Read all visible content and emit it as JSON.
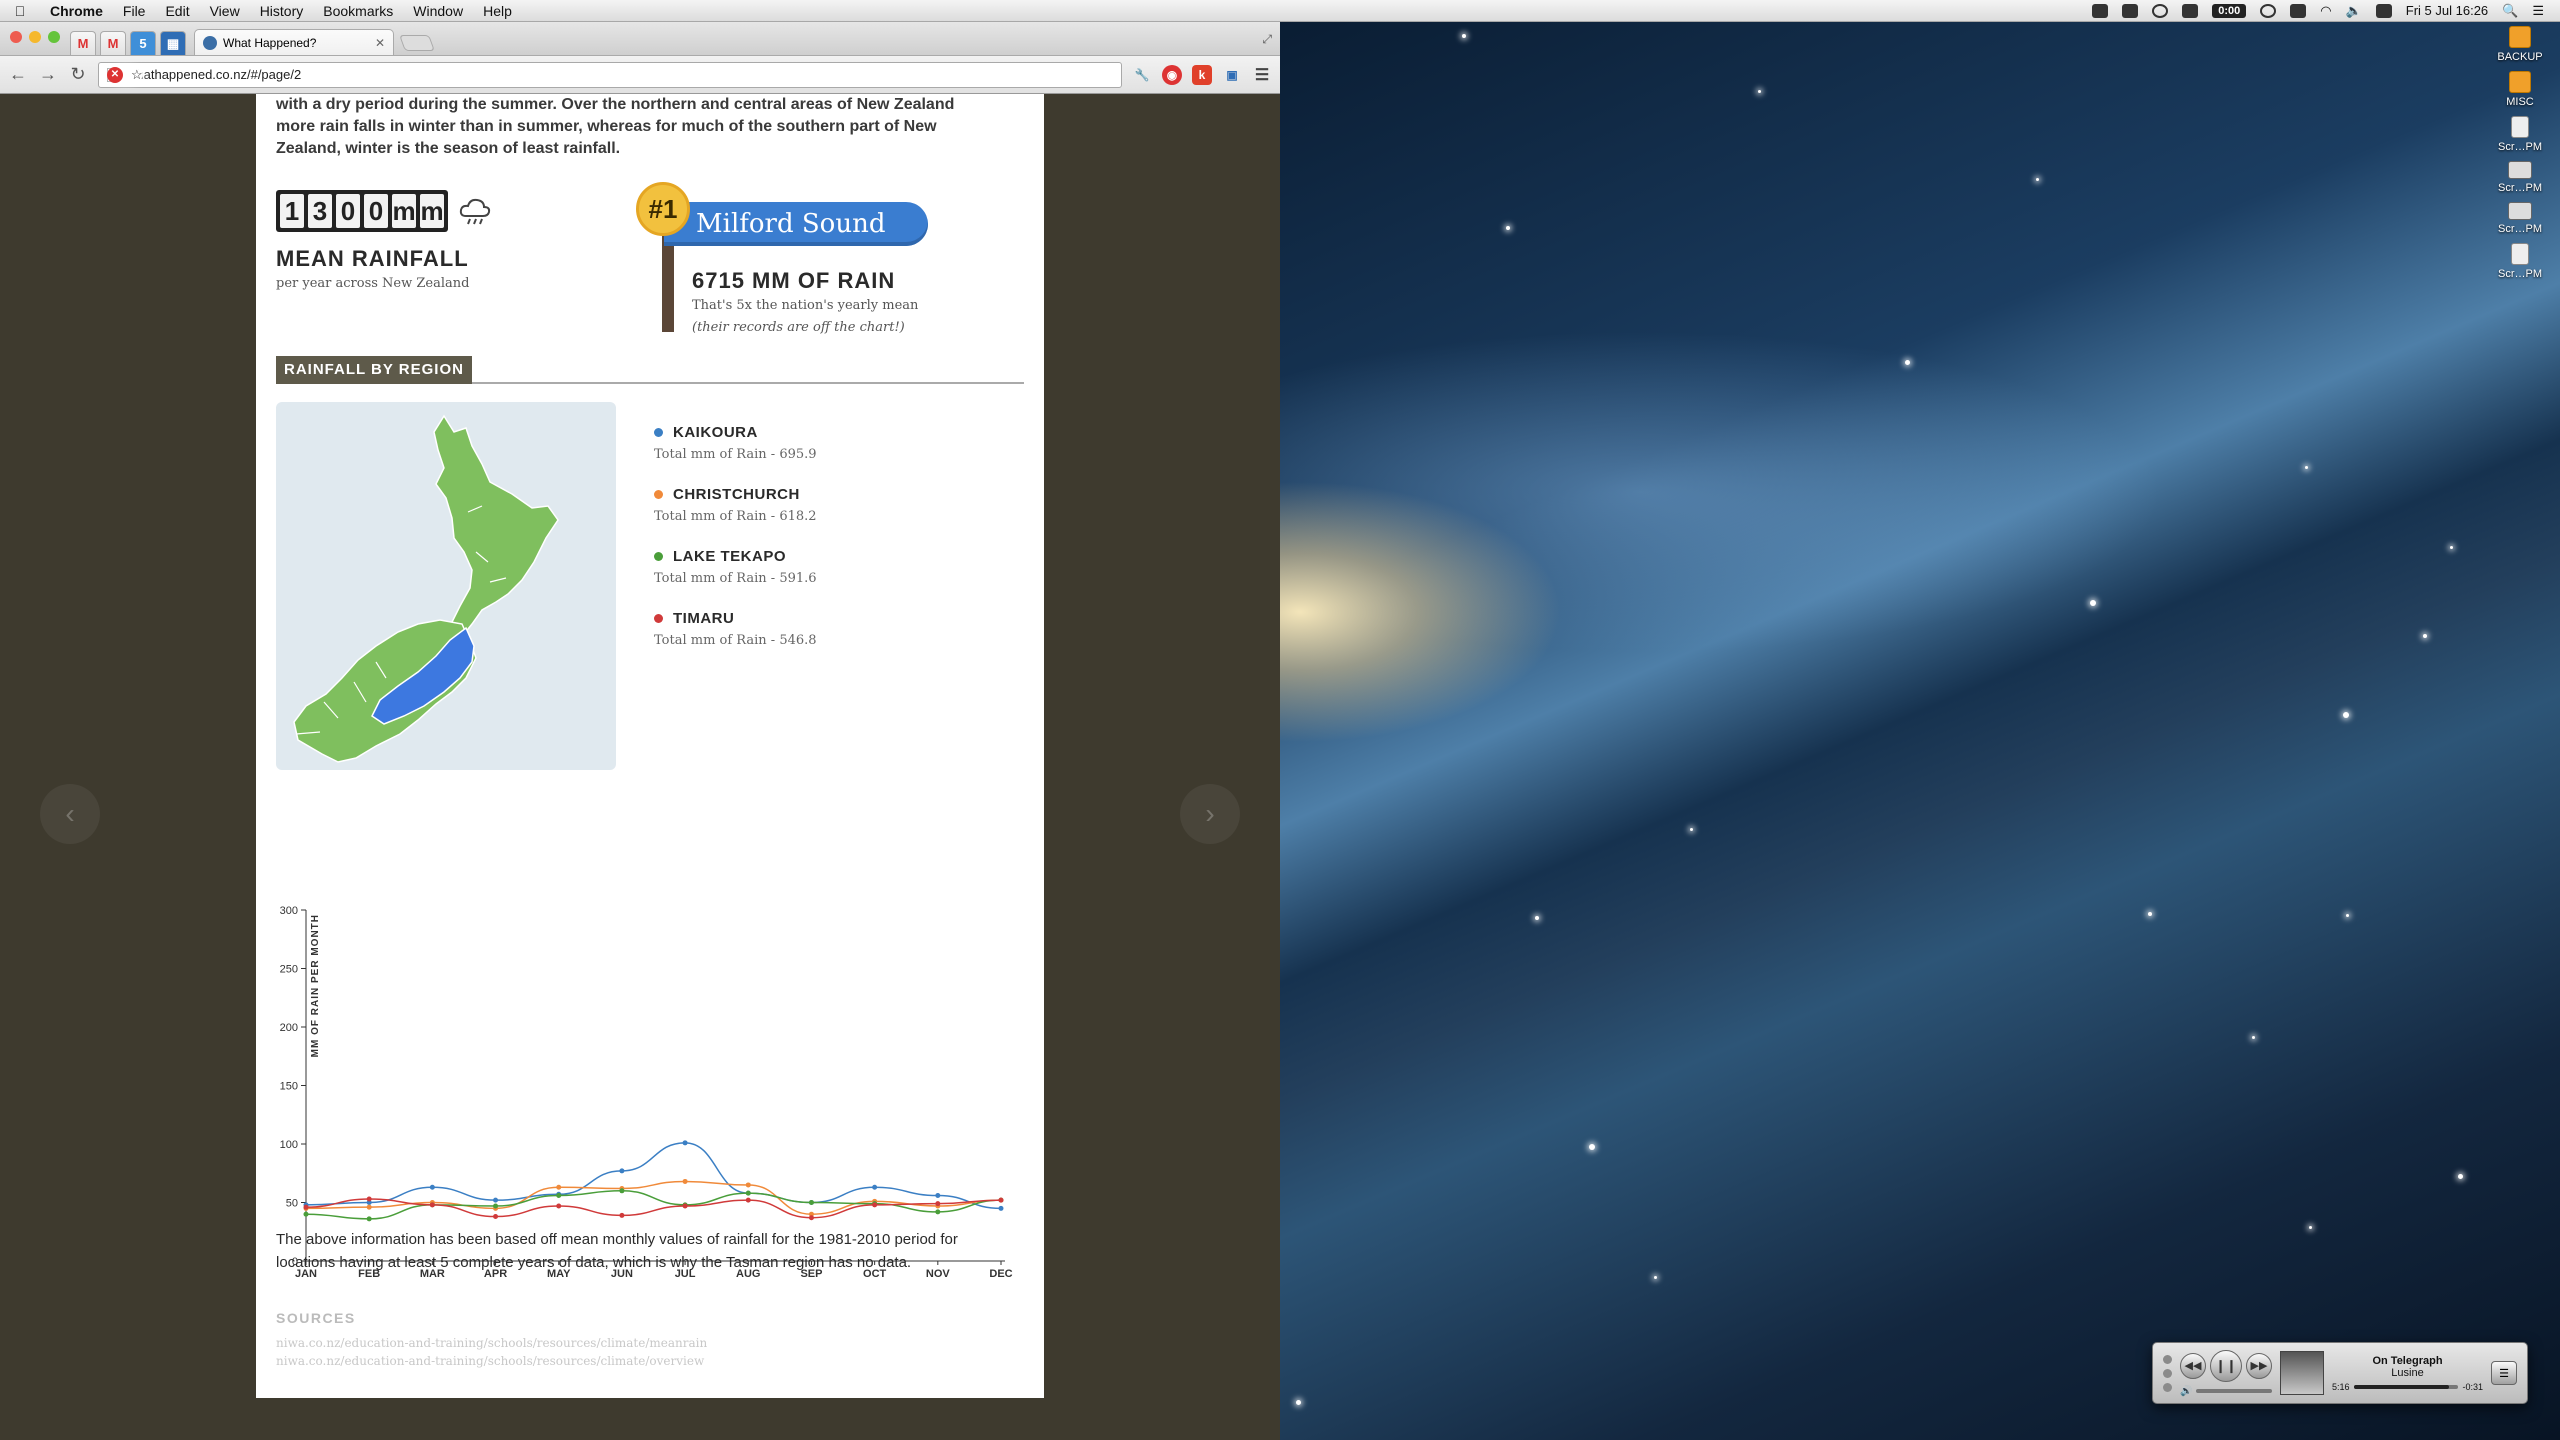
{
  "menubar": {
    "app": "Chrome",
    "menus": [
      "File",
      "Edit",
      "View",
      "History",
      "Bookmarks",
      "Window",
      "Help"
    ],
    "timer": "0:00",
    "clock": "Fri 5 Jul  16:26"
  },
  "browser": {
    "tab_title": "What Happened?",
    "url": "whathappened.co.nz/#/page/2"
  },
  "page": {
    "intro": "with a dry period during the summer. Over the northern and central areas of New Zealand more rain falls in winter than in summer, whereas for much of the southern part of New Zealand, winter is the season of least rainfall.",
    "counter_digits": [
      "1",
      "3",
      "0",
      "0",
      "m",
      "m"
    ],
    "mean_title": "MEAN RAINFALL",
    "mean_sub": "per year across New Zealand",
    "rank_badge": "#1",
    "rank_sign": "Milford Sound",
    "rank_title": "6715 MM OF RAIN",
    "rank_sub1": "That's 5x the nation's yearly mean",
    "rank_sub2": "(their records are off the chart!)",
    "section_title": "RAINFALL BY REGION",
    "legend": [
      {
        "name": "KAIKOURA",
        "total": "Total mm of Rain - 695.9",
        "color": "#3b7fc4"
      },
      {
        "name": "CHRISTCHURCH",
        "total": "Total mm of Rain - 618.2",
        "color": "#f08a3a"
      },
      {
        "name": "LAKE TEKAPO",
        "total": "Total mm of Rain - 591.6",
        "color": "#4a9e3a"
      },
      {
        "name": "TIMARU",
        "total": "Total mm of Rain - 546.8",
        "color": "#d03a3a"
      }
    ],
    "footnote": "The above information has been based off mean monthly values of rainfall for the 1981-2010 period for locations having at least 5 complete years of data, which is why the Tasman region has no data.",
    "sources_title": "SOURCES",
    "sources": [
      "niwa.co.nz/education-and-training/schools/resources/climate/meanrain",
      "niwa.co.nz/education-and-training/schools/resources/climate/overview"
    ]
  },
  "desktop": {
    "icons": [
      "BACKUP",
      "MISC",
      "Scr…PM",
      "Scr…PM",
      "Scr…PM",
      "Scr…PM"
    ]
  },
  "player": {
    "track": "On Telegraph",
    "artist": "Lusine",
    "elapsed": "5:16",
    "remaining": "-0:31",
    "progress": 0.91
  },
  "chart_data": {
    "type": "line",
    "categories": [
      "JAN",
      "FEB",
      "MAR",
      "APR",
      "MAY",
      "JUN",
      "JUL",
      "AUG",
      "SEP",
      "OCT",
      "NOV",
      "DEC"
    ],
    "ylabel": "MM OF RAIN PER MONTH",
    "ylim": [
      0,
      300
    ],
    "yticks": [
      0,
      50,
      100,
      150,
      200,
      250,
      300
    ],
    "grid": false,
    "series": [
      {
        "name": "KAIKOURA",
        "color": "#3b7fc4",
        "values": [
          48,
          50,
          63,
          52,
          57,
          77,
          101,
          58,
          50,
          63,
          56,
          45
        ]
      },
      {
        "name": "CHRISTCHURCH",
        "color": "#f08a3a",
        "values": [
          45,
          46,
          50,
          45,
          63,
          62,
          68,
          65,
          40,
          51,
          47,
          52
        ]
      },
      {
        "name": "LAKE TEKAPO",
        "color": "#4a9e3a",
        "values": [
          40,
          36,
          48,
          47,
          56,
          60,
          48,
          58,
          50,
          49,
          42,
          52
        ]
      },
      {
        "name": "TIMARU",
        "color": "#d03a3a",
        "values": [
          46,
          53,
          48,
          38,
          47,
          39,
          47,
          52,
          37,
          48,
          49,
          52
        ]
      }
    ]
  }
}
